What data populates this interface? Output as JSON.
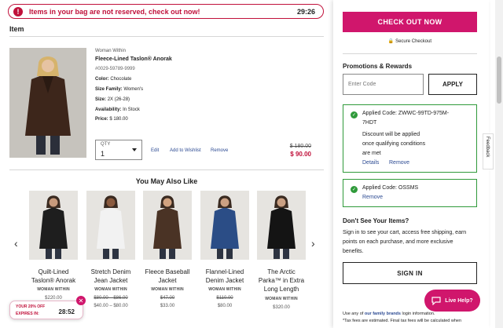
{
  "alert": {
    "text": "Items in your bag are not reserved, check out now!",
    "timer": "29:26",
    "icon": "alert-icon"
  },
  "cart": {
    "heading": "Item",
    "product": {
      "brand": "Woman Within",
      "name": "Fleece-Lined Taslon® Anorak",
      "sku": "#0029-59789-9999",
      "color_label": "Color:",
      "color_value": "Chocolate",
      "size_family_label": "Size Family:",
      "size_family_value": "Women's",
      "size_label": "Size:",
      "size_value": "2X (26-28)",
      "availability_label": "Availability:",
      "availability_value": "In Stock",
      "price_label": "Price:",
      "price_value": "$ 180.00",
      "qty_caption": "QTY",
      "qty_value": "1",
      "edit": "Edit",
      "add_wishlist": "Add to Wishlist",
      "remove": "Remove",
      "price_old": "$ 180.00",
      "price_new": "$ 90.00"
    }
  },
  "recommendations": {
    "title": "You May Also Like",
    "items": [
      {
        "name_l1": "Quilt-Lined",
        "name_l2": "Taslon® Anorak",
        "name_l3": "",
        "brand": "WOMAN WITHIN",
        "price_l1": "$220.00",
        "price_l2": "",
        "coat": "#1e1e1e",
        "skin": "#c79a7c"
      },
      {
        "name_l1": "Stretch Denim",
        "name_l2": "Jean Jacket",
        "name_l3": "",
        "brand": "WOMAN WITHIN",
        "price_l1": "$80.00 – $86.00",
        "price_l2": "$40.00 – $80.00",
        "coat": "#f2f2f2",
        "skin": "#8a5a3e"
      },
      {
        "name_l1": "Fleece Baseball",
        "name_l2": "Jacket",
        "name_l3": "",
        "brand": "WOMAN WITHIN",
        "price_l1": "$47.00",
        "price_l2": "$33.00",
        "coat": "#4a3325",
        "skin": "#d1a27f"
      },
      {
        "name_l1": "Flannel-Lined",
        "name_l2": "Denim Jacket",
        "name_l3": "",
        "brand": "WOMAN WITHIN",
        "price_l1": "$110.00",
        "price_l2": "$80.00",
        "coat": "#2b4d86",
        "skin": "#caa083"
      },
      {
        "name_l1": "The Arctic",
        "name_l2": "Parka™ in Extra",
        "name_l3": "Long Length",
        "brand": "WOMAN WITHIN",
        "price_l1": "$320.00",
        "price_l2": "",
        "coat": "#141414",
        "skin": "#caa083"
      }
    ],
    "prev_icon": "chevron-left-icon",
    "next_icon": "chevron-right-icon"
  },
  "promo_popup": {
    "line1": "YOUR 20% OFF",
    "line2": "EXPIRES IN:",
    "timer": "28:52",
    "close": "✕"
  },
  "summary": {
    "checkout": "CHECK OUT NOW",
    "secure": "Secure Checkout",
    "promotions_heading": "Promotions & Rewards",
    "code_placeholder": "Enter Code",
    "apply": "APPLY",
    "applied1": {
      "line1": "Applied Code: ZWWC-99TD-975M-",
      "line2": "7HDT",
      "line3": "Discount will be applied",
      "line4": "once qualifying conditions",
      "line5": "are met",
      "details": "Details",
      "remove": "Remove"
    },
    "applied2": {
      "line1": "Applied Code: OSSMS",
      "remove": "Remove"
    },
    "missing_heading": "Don't See Your Items?",
    "missing_l1": "Sign in to see your cart, access free shipping, earn",
    "missing_l2": "points on each purchase, and more exclusive",
    "missing_l3": "benefits.",
    "signin": "SIGN IN",
    "family_prefix": "Use any of",
    "family_link": "our family brands",
    "family_suffix": "login information.",
    "tax": "*Tax fees are estimated. Final tax fees will be calculated when"
  },
  "live_help": "Live Help?",
  "feedback": "Feedback",
  "colors": {
    "brand_pink": "#d0166c",
    "alert_red": "#c0103a",
    "success_green": "#2f9a3a",
    "link_blue": "#2d4b93"
  }
}
